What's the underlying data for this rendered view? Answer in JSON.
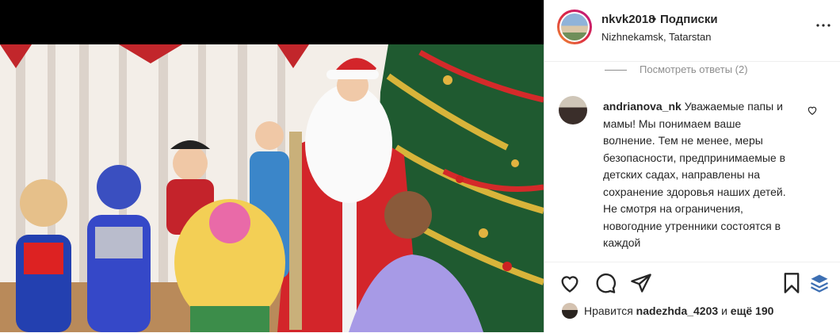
{
  "post": {
    "username": "nkvk2018",
    "separator": "•",
    "follow_label": "Подписки",
    "location": "Nizhnekamsk, Tatarstan"
  },
  "thread": {
    "view_replies": "Посмотреть ответы (2)"
  },
  "comment": {
    "username": "andrianova_nk",
    "text": "Уважаемые папы и мамы! Мы понимаем ваше волнение. Тем не менее, меры безопасности, предпринимаемые в детских садах, направлены на сохранение здоровья наших детей. Не смотря на ограничения, новогодние утренники состоятся в каждой"
  },
  "likes": {
    "prefix": "Нравится",
    "user": "nadezhda_4203",
    "conj": "и",
    "count_text": "ещё 190"
  },
  "icons": [
    "more-icon",
    "heart-icon",
    "comment-icon",
    "share-icon",
    "bookmark-icon",
    "layers-icon"
  ],
  "colors": {
    "text": "#262626",
    "muted": "#8e8e8e",
    "border": "#dbdbdb"
  }
}
